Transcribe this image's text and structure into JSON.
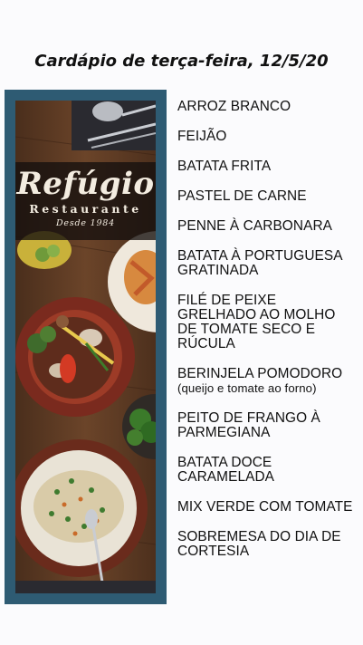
{
  "title": "Cardápio de terça-feira, 12/5/20",
  "logo": {
    "name": "Refúgio",
    "subtitle": "Restaurante",
    "since": "Desde 1984"
  },
  "menu_items": [
    {
      "name": "ARROZ BRANCO"
    },
    {
      "name": "FEIJÃO"
    },
    {
      "name": "BATATA FRITA"
    },
    {
      "name": "PASTEL DE CARNE"
    },
    {
      "name": "PENNE À CARBONARA"
    },
    {
      "name": "BATATA À PORTUGUESA GRATINADA"
    },
    {
      "name": "FILÉ DE PEIXE GRELHADO AO MOLHO DE TOMATE SECO E RÚCULA"
    },
    {
      "name": "BERINJELA POMODORO",
      "note": "(queijo e tomate ao forno)"
    },
    {
      "name": "PEITO DE FRANGO À PARMEGIANA"
    },
    {
      "name": "BATATA DOCE CARAMELADA"
    },
    {
      "name": "MIX VERDE COM TOMATE"
    },
    {
      "name": "SOBREMESA DO DIA DE CORTESIA"
    }
  ],
  "colors": {
    "frame": "#2e5b73",
    "table_wood": "#5a3a24",
    "text": "#111111"
  }
}
